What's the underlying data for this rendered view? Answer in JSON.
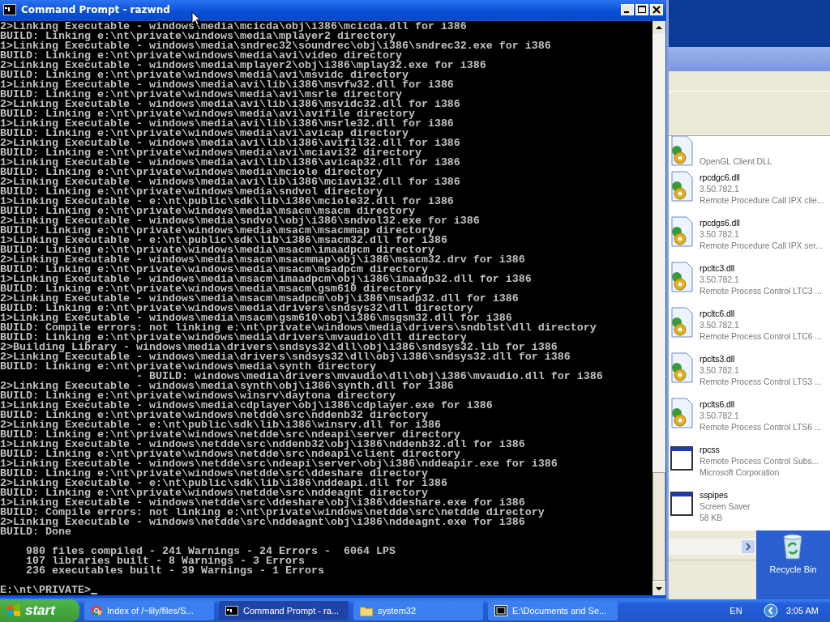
{
  "console_window": {
    "title": "Command Prompt - razwnd",
    "output_lines": [
      "2>Linking Executable - windows\\media\\mcicda\\obj\\i386\\mcicda.dll for i386",
      "BUILD: Linking e:\\nt\\private\\windows\\media\\mplayer2 directory",
      "1>Linking Executable - windows\\media\\sndrec32\\soundrec\\obj\\i386\\sndrec32.exe for i386",
      "BUILD: Linking e:\\nt\\private\\windows\\media\\avi\\video directory",
      "2>Linking Executable - windows\\media\\mplayer2\\obj\\i386\\mplay32.exe for i386",
      "BUILD: Linking e:\\nt\\private\\windows\\media\\avi\\msvidc directory",
      "1>Linking Executable - windows\\media\\avi\\lib\\i386\\msvfw32.dll for i386",
      "BUILD: Linking e:\\nt\\private\\windows\\media\\avi\\msrle directory",
      "2>Linking Executable - windows\\media\\avi\\lib\\i386\\msvidc32.dll for i386",
      "BUILD: Linking e:\\nt\\private\\windows\\media\\avi\\avifile directory",
      "1>Linking Executable - windows\\media\\avi\\lib\\i386\\msrle32.dll for i386",
      "BUILD: Linking e:\\nt\\private\\windows\\media\\avi\\avicap directory",
      "2>Linking Executable - windows\\media\\avi\\lib\\i386\\avifil32.dll for i386",
      "BUILD: Linking e:\\nt\\private\\windows\\media\\avi\\mciavi32 directory",
      "1>Linking Executable - windows\\media\\avi\\lib\\i386\\avicap32.dll for i386",
      "BUILD: Linking e:\\nt\\private\\windows\\media\\mciole directory",
      "2>Linking Executable - windows\\media\\avi\\lib\\i386\\mciavi32.dll for i386",
      "BUILD: Linking e:\\nt\\private\\windows\\media\\sndvol directory",
      "1>Linking Executable - e:\\nt\\public\\sdk\\lib\\i386\\mciole32.dll for i386",
      "BUILD: Linking e:\\nt\\private\\windows\\media\\msacm\\msacm directory",
      "2>Linking Executable - windows\\media\\sndvol\\obj\\i386\\sndvol32.exe for i386",
      "BUILD: Linking e:\\nt\\private\\windows\\media\\msacm\\msacmmap directory",
      "1>Linking Executable - e:\\nt\\public\\sdk\\lib\\i386\\msacm32.dll for i386",
      "BUILD: Linking e:\\nt\\private\\windows\\media\\msacm\\imaadpcm directory",
      "2>Linking Executable - windows\\media\\msacm\\msacmmap\\obj\\i386\\msacm32.drv for i386",
      "BUILD: Linking e:\\nt\\private\\windows\\media\\msacm\\msadpcm directory",
      "1>Linking Executable - windows\\media\\msacm\\imaadpcm\\obj\\i386\\imaadp32.dll for i386",
      "BUILD: Linking e:\\nt\\private\\windows\\media\\msacm\\gsm610 directory",
      "2>Linking Executable - windows\\media\\msacm\\msadpcm\\obj\\i386\\msadp32.dll for i386",
      "BUILD: Linking e:\\nt\\private\\windows\\media\\drivers\\sndsys32\\dll directory",
      "1>Linking Executable - windows\\media\\msacm\\gsm610\\obj\\i386\\msgsm32.dll for i386",
      "BUILD: Compile errors: not linking e:\\nt\\private\\windows\\media\\drivers\\sndblst\\dll directory",
      "BUILD: Linking e:\\nt\\private\\windows\\media\\drivers\\mvaudio\\dll directory",
      "2>Building Library - windows\\media\\drivers\\sndsys32\\dll\\obj\\i386\\sndsys32.lib for i386",
      "2>Linking Executable - windows\\media\\drivers\\sndsys32\\dll\\obj\\i386\\sndsys32.dll for i386",
      "BUILD: Linking e:\\nt\\private\\windows\\media\\synth directory",
      "                     - BUILD: windows\\media\\drivers\\mvaudio\\dll\\obj\\i386\\mvaudio.dll for i386",
      "2>Linking Executable - windows\\media\\synth\\obj\\i386\\synth.dll for i386",
      "BUILD: Linking e:\\nt\\private\\windows\\winsrv\\daytona directory",
      "1>Linking Executable - windows\\media\\cdplayer\\obj\\i386\\cdplayer.exe for i386",
      "BUILD: Linking e:\\nt\\private\\windows\\netdde\\src\\nddenb32 directory",
      "2>Linking Executable - e:\\nt\\public\\sdk\\lib\\i386\\winsrv.dll for i386",
      "BUILD: Linking e:\\nt\\private\\windows\\netdde\\src\\ndeapi\\server directory",
      "1>Linking Executable - windows\\netdde\\src\\nddenb32\\obj\\i386\\nddenb32.dll for i386",
      "BUILD: Linking e:\\nt\\private\\windows\\netdde\\src\\ndeapi\\client directory",
      "1>Linking Executable - windows\\netdde\\src\\ndeapi\\server\\obj\\i386\\nddeapir.exe for i386",
      "BUILD: Linking e:\\nt\\private\\windows\\netdde\\src\\ddeshare directory",
      "2>Linking Executable - e:\\nt\\public\\sdk\\lib\\i386\\nddeapi.dll for i386",
      "BUILD: Linking e:\\nt\\private\\windows\\netdde\\src\\nddeagnt directory",
      "1>Linking Executable - windows\\netdde\\src\\ddeshare\\obj\\i386\\ddeshare.exe for i386",
      "BUILD: Compile errors: not linking e:\\nt\\private\\windows\\netdde\\src\\netdde directory",
      "2>Linking Executable - windows\\netdde\\src\\nddeagnt\\obj\\i386\\nddeagnt.exe for i386",
      "BUILD: Done"
    ],
    "summary_lines": [
      "    980 files compiled - 241 Warnings - 24 Errors -  6064 LPS",
      "    107 libraries built - 8 Warnings - 3 Errors",
      "    236 executables built - 39 Warnings - 1 Errors"
    ],
    "prompt": "E:\\nt\\PRIVATE>"
  },
  "explorer_window": {
    "files": [
      {
        "kind": "dll",
        "lines": [
          "OpenGL Client DLL"
        ]
      },
      {
        "kind": "dll",
        "lines": [
          "rpcdgc6.dll",
          "3.50.782.1",
          "Remote Procedure Call IPX clie..."
        ]
      },
      {
        "kind": "dll",
        "lines": [
          "rpcdgs6.dll",
          "3.50.782.1",
          "Remote Procedure Call IPX ser..."
        ]
      },
      {
        "kind": "dll",
        "lines": [
          "rpcltc3.dll",
          "3.50.782.1",
          "Remote Process Control LTC3 ..."
        ]
      },
      {
        "kind": "dll",
        "lines": [
          "rpcltc6.dll",
          "3.50.782.1",
          "Remote Process Control LTC6 ..."
        ]
      },
      {
        "kind": "dll",
        "lines": [
          "rpclts3.dll",
          "3.50.782.1",
          "Remote Process Control LTS3 ..."
        ]
      },
      {
        "kind": "dll",
        "lines": [
          "rpclts6.dll",
          "3.50.782.1",
          "Remote Process Control LTS6 ..."
        ]
      },
      {
        "kind": "app",
        "lines": [
          "rpcss",
          "Remote Process Control Subs...",
          "Microsoft Corporation"
        ]
      },
      {
        "kind": "app",
        "lines": [
          "sspipes",
          "Screen Saver",
          "58 KB"
        ]
      }
    ]
  },
  "desktop": {
    "icons": [
      {
        "label": "Recycle Bin"
      }
    ]
  },
  "taskbar": {
    "start_label": "start",
    "tasks": [
      {
        "kind": "browser",
        "label": "Index of /~lily/files/S...",
        "selected": false
      },
      {
        "kind": "console",
        "label": "Command Prompt - ra...",
        "selected": true
      },
      {
        "kind": "folder",
        "label": "system32",
        "selected": false
      },
      {
        "kind": "archive",
        "label": "E:\\Documents and Se...",
        "selected": false
      }
    ],
    "language": "EN",
    "clock": "3:05 AM"
  }
}
